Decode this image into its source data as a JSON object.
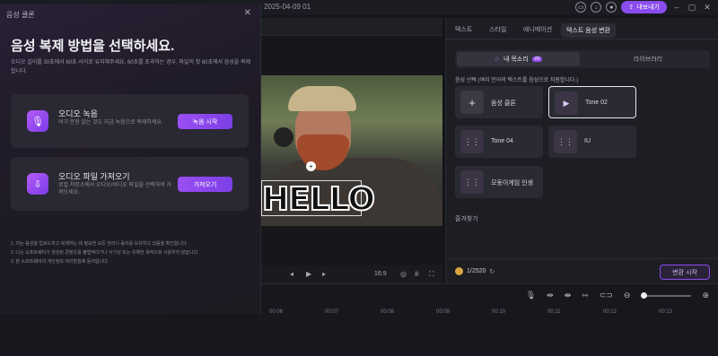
{
  "topbar": {
    "date": "2025-04-09 01",
    "export_label": "내보내기"
  },
  "dialog": {
    "title": "음성 클론",
    "heading": "음성 복제 방법을 선택하세요.",
    "description": "오디오 길이를 30초에서 60초 사이로 유지해주세요. 60초를 초과하는 경우, 파일의 첫 60초에서 음성을 복제합니다.",
    "cards": [
      {
        "title": "오디오 녹음",
        "subtitle": "여기 문장 읽는 것도 지금 녹음으로 복제하세요.",
        "button": "녹음 시작",
        "icon": "microphone-icon"
      },
      {
        "title": "오디오 파일 가져오기",
        "subtitle": "로컬 저장소에서 오디오/비디오 파일을 선택하여 가져오세요.",
        "button": "가져오기",
        "icon": "file-import-icon"
      }
    ],
    "notes": [
      "1. 저는 음성을 업로드하고 복제하는 데 필요한 모든 권리나 동의를 보유하고 있음을 확인합니다.",
      "2. 나는 소프트웨어가 생성된 콘텐츠를 불법적이거나 사기성 또는 유해한 목적으로 사용하지 않습니다.",
      "3. 본 소프트웨어의 개인정보 처리방침에 동의합니다."
    ]
  },
  "video": {
    "overlay_text": "HELLO",
    "ratio": "16:9"
  },
  "right_panel": {
    "tabs": [
      "텍스트",
      "스타일",
      "애니메이션",
      "텍스트 음성 변환"
    ],
    "active_tab": 3,
    "segment_mine": "내 목소리",
    "segment_ai": "AI",
    "segment_library": "라이브러리",
    "hint": "음성 선택 (여러 언어의 텍스트를 음성으로 지원합니다.)",
    "voices": [
      {
        "label": "음성 클론",
        "icon": "plus-icon"
      },
      {
        "label": "Tone 02",
        "icon": "voice-wave-icon",
        "selected": true
      },
      {
        "label": "Tone 04",
        "icon": "voice-wave-icon"
      },
      {
        "label": "IU",
        "icon": "voice-wave-icon"
      },
      {
        "label": "모동이게임 인생",
        "icon": "voice-wave-icon"
      }
    ],
    "favorites": "즐겨찾기",
    "credits": "1/2520",
    "convert_button": "변환 시작"
  },
  "timeline": {
    "ticks": [
      "00:06",
      "00:07",
      "00:08",
      "00:09",
      "00:10",
      "00:11",
      "00:12",
      "00:13"
    ]
  }
}
